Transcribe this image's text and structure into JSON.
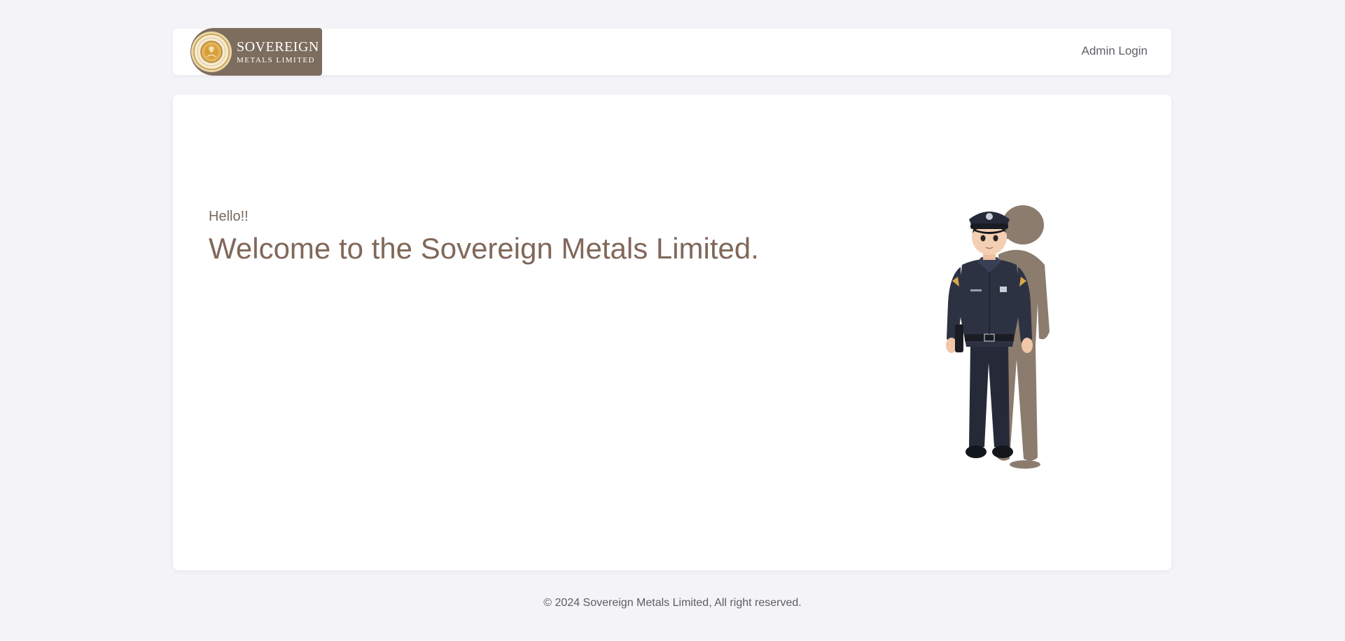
{
  "header": {
    "logo": {
      "title": "SOVEREIGN",
      "subtitle": "METALS LIMITED",
      "seal_icon": "sovereign-seal-icon"
    },
    "admin_login_label": "Admin Login"
  },
  "hero": {
    "greeting": "Hello!!",
    "headline": "Welcome to the Sovereign Metals Limited.",
    "illustration": "security-guard-illustration"
  },
  "footer": {
    "copyright": "© 2024 Sovereign Metals Limited, All right reserved."
  },
  "colors": {
    "page_background": "#f4f4f8",
    "card_background": "#ffffff",
    "brand_brown": "#7d6d5e",
    "headline_text": "#80685a",
    "uniform_navy": "#262a38",
    "gold": "#d9a84a"
  }
}
